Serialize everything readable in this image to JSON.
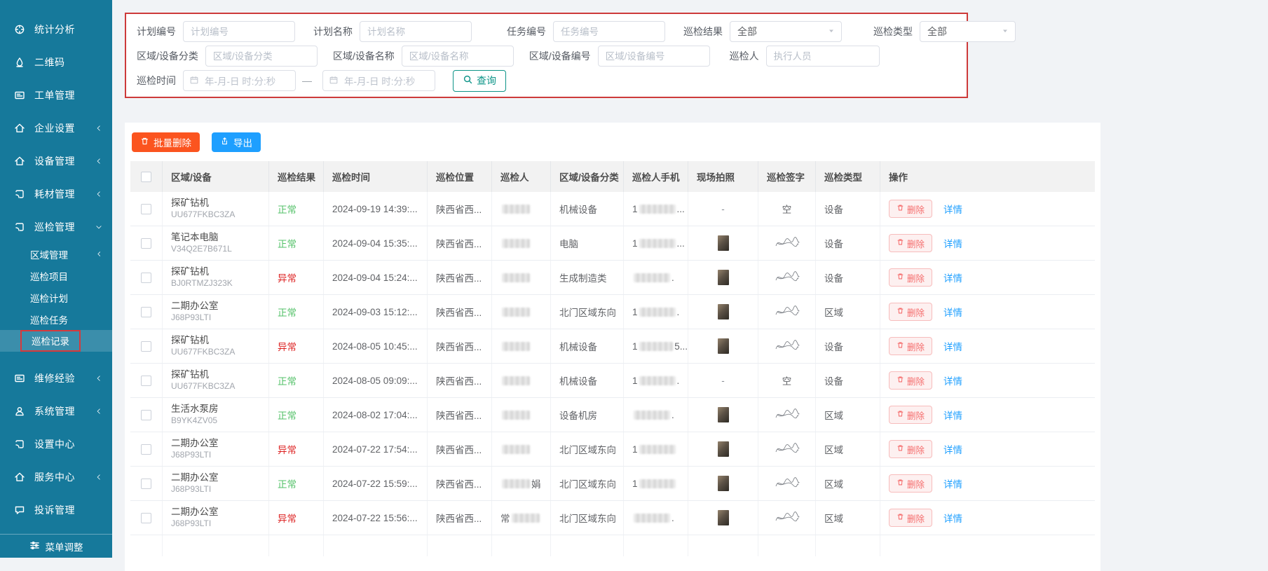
{
  "sidebar": {
    "items": [
      {
        "label": "统计分析",
        "icon": "statistics-icon"
      },
      {
        "label": "二维码",
        "icon": "qrcode-icon"
      },
      {
        "label": "工单管理",
        "icon": "workorder-icon"
      },
      {
        "label": "企业设置",
        "icon": "home-icon",
        "chevron": "collapsed"
      },
      {
        "label": "设备管理",
        "icon": "home-icon",
        "chevron": "collapsed"
      },
      {
        "label": "耗材管理",
        "icon": "package-icon",
        "chevron": "collapsed"
      },
      {
        "label": "巡检管理",
        "icon": "package-icon",
        "chevron": "expanded"
      }
    ],
    "inspection_submenu": [
      {
        "label": "区域管理",
        "chevron": "collapsed"
      },
      {
        "label": "巡检项目"
      },
      {
        "label": "巡检计划"
      },
      {
        "label": "巡检任务"
      },
      {
        "label": "巡检记录",
        "active": true,
        "highlighted": true
      }
    ],
    "items_after": [
      {
        "label": "维修经验",
        "icon": "experience-icon",
        "chevron": "collapsed"
      },
      {
        "label": "系统管理",
        "icon": "user-icon",
        "chevron": "collapsed"
      },
      {
        "label": "设置中心",
        "icon": "folder-icon"
      },
      {
        "label": "服务中心",
        "icon": "home-icon",
        "chevron": "collapsed"
      },
      {
        "label": "投诉管理",
        "icon": "chat-icon"
      }
    ],
    "footer": {
      "label": "菜单调整",
      "icon": "sliders-icon"
    }
  },
  "filters": {
    "row1": [
      {
        "label": "计划编号",
        "placeholder": "计划编号"
      },
      {
        "label": "计划名称",
        "placeholder": "计划名称"
      },
      {
        "label": "任务编号",
        "placeholder": "任务编号"
      },
      {
        "label": "巡检结果",
        "value": "全部"
      },
      {
        "label": "巡检类型",
        "value": "全部"
      }
    ],
    "row2": [
      {
        "label": "区域/设备分类",
        "placeholder": "区域/设备分类"
      },
      {
        "label": "区域/设备名称",
        "placeholder": "区域/设备名称"
      },
      {
        "label": "区域/设备编号",
        "placeholder": "区域/设备编号"
      },
      {
        "label": "巡检人",
        "placeholder": "执行人员"
      }
    ],
    "row3": {
      "label": "巡检时间",
      "date_start_placeholder": "年-月-日 时:分:秒",
      "date_end_placeholder": "年-月-日 时:分:秒",
      "separator": "—",
      "search_label": "查询"
    }
  },
  "toolbar": {
    "batch_delete_label": "批量删除",
    "export_label": "导出"
  },
  "table": {
    "columns": [
      "",
      "区域/设备",
      "巡检结果",
      "巡检时间",
      "巡检位置",
      "巡检人",
      "区域/设备分类",
      "巡检人手机",
      "现场拍照",
      "巡检签字",
      "巡检类型",
      "操作"
    ],
    "status_colors": {
      "正常": "#53c168",
      "异常": "#dd2222"
    },
    "actions": {
      "delete_label": "删除",
      "detail_label": "详情"
    },
    "empty_photo": "-",
    "empty_signature": "空",
    "rows": [
      {
        "device_name": "探矿钻机",
        "device_code": "UU677FKBC3ZA",
        "result": "正常",
        "time": "2024-09-19 14:39:...",
        "location": "陕西省西...",
        "inspector_prefix": "",
        "inspector_suffix": "",
        "category": "机械设备",
        "phone_prefix": "1",
        "phone_suffix": "...",
        "photo": "dash",
        "signature": "empty",
        "type": "设备"
      },
      {
        "device_name": "笔记本电脑",
        "device_code": "V34Q2E7B671L",
        "result": "正常",
        "time": "2024-09-04 15:35:...",
        "location": "陕西省西...",
        "inspector_prefix": "",
        "inspector_suffix": "",
        "category": "电脑",
        "phone_prefix": "1",
        "phone_suffix": "...",
        "photo": "image",
        "signature": "scribble",
        "type": "设备"
      },
      {
        "device_name": "探矿钻机",
        "device_code": "BJ0RTMZJ323K",
        "result": "异常",
        "time": "2024-09-04 15:24:...",
        "location": "陕西省西...",
        "inspector_prefix": "",
        "inspector_suffix": "",
        "category": "生成制造类",
        "phone_prefix": "",
        "phone_suffix": ".",
        "photo": "image",
        "signature": "scribble",
        "type": "设备"
      },
      {
        "device_name": "二期办公室",
        "device_code": "J68P93LTI",
        "result": "正常",
        "time": "2024-09-03 15:12:...",
        "location": "陕西省西...",
        "inspector_prefix": "",
        "inspector_suffix": "",
        "category": "北门区域东向",
        "phone_prefix": "1",
        "phone_suffix": ".",
        "photo": "image",
        "signature": "scribble",
        "type": "区域"
      },
      {
        "device_name": "探矿钻机",
        "device_code": "UU677FKBC3ZA",
        "result": "异常",
        "time": "2024-08-05 10:45:...",
        "location": "陕西省西...",
        "inspector_prefix": "",
        "inspector_suffix": "",
        "category": "机械设备",
        "phone_prefix": "1",
        "phone_suffix": "5...",
        "photo": "image",
        "signature": "scribble",
        "type": "设备"
      },
      {
        "device_name": "探矿钻机",
        "device_code": "UU677FKBC3ZA",
        "result": "正常",
        "time": "2024-08-05 09:09:...",
        "location": "陕西省西...",
        "inspector_prefix": "",
        "inspector_suffix": "",
        "category": "机械设备",
        "phone_prefix": "1",
        "phone_suffix": ".",
        "photo": "dash",
        "signature": "empty",
        "type": "设备"
      },
      {
        "device_name": "生活水泵房",
        "device_code": "B9YK4ZV05",
        "result": "正常",
        "time": "2024-08-02 17:04:...",
        "location": "陕西省西...",
        "inspector_prefix": "",
        "inspector_suffix": "",
        "category": "设备机房",
        "phone_prefix": "",
        "phone_suffix": ".",
        "photo": "image",
        "signature": "scribble",
        "type": "区域"
      },
      {
        "device_name": "二期办公室",
        "device_code": "J68P93LTI",
        "result": "异常",
        "time": "2024-07-22 17:54:...",
        "location": "陕西省西...",
        "inspector_prefix": "",
        "inspector_suffix": "",
        "category": "北门区域东向",
        "phone_prefix": "1",
        "phone_suffix": "",
        "photo": "image",
        "signature": "scribble",
        "type": "区域"
      },
      {
        "device_name": "二期办公室",
        "device_code": "J68P93LTI",
        "result": "正常",
        "time": "2024-07-22 15:59:...",
        "location": "陕西省西...",
        "inspector_prefix": "",
        "inspector_suffix": "娟",
        "category": "北门区域东向",
        "phone_prefix": "1",
        "phone_suffix": "",
        "photo": "image",
        "signature": "scribble",
        "type": "区域"
      },
      {
        "device_name": "二期办公室",
        "device_code": "J68P93LTI",
        "result": "异常",
        "time": "2024-07-22 15:56:...",
        "location": "陕西省西...",
        "inspector_prefix": "常",
        "inspector_suffix": "",
        "category": "北门区域东向",
        "phone_prefix": "",
        "phone_suffix": ".",
        "photo": "image",
        "signature": "scribble",
        "type": "区域"
      }
    ]
  }
}
